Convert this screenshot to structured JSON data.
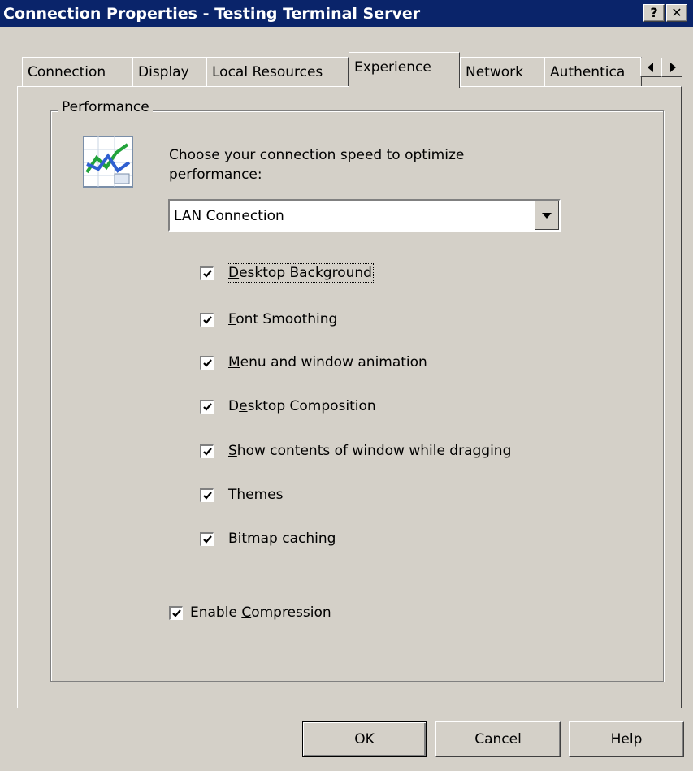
{
  "window": {
    "title": "Connection Properties - Testing Terminal Server",
    "help_glyph": "?",
    "close_glyph": "✕"
  },
  "tabs": [
    {
      "label": "Connection"
    },
    {
      "label": "Display"
    },
    {
      "label": "Local Resources"
    },
    {
      "label": "Experience",
      "active": true
    },
    {
      "label": "Network"
    },
    {
      "label": "Authentica"
    }
  ],
  "performance": {
    "group_label": "Performance",
    "icon": "performance-chart-icon",
    "prompt_line1": "Choose your connection speed to optimize",
    "prompt_line2": "performance:",
    "speed_selected": "LAN Connection",
    "options": [
      {
        "pre": "",
        "key": "D",
        "post": "esktop Background",
        "checked": true
      },
      {
        "pre": "",
        "key": "F",
        "post": "ont Smoothing",
        "checked": true
      },
      {
        "pre": "",
        "key": "M",
        "post": "enu and window animation",
        "checked": true
      },
      {
        "pre": "D",
        "key": "e",
        "post": "sktop Composition",
        "checked": true
      },
      {
        "pre": "",
        "key": "S",
        "post": "how contents of window while dragging",
        "checked": true
      },
      {
        "pre": "",
        "key": "T",
        "post": "hemes",
        "checked": true
      },
      {
        "pre": "",
        "key": "B",
        "post": "itmap caching",
        "checked": true
      }
    ],
    "compression": {
      "pre": "Enable ",
      "key": "C",
      "post": "ompression",
      "checked": true
    }
  },
  "buttons": {
    "ok": "OK",
    "cancel": "Cancel",
    "help": "Help"
  }
}
